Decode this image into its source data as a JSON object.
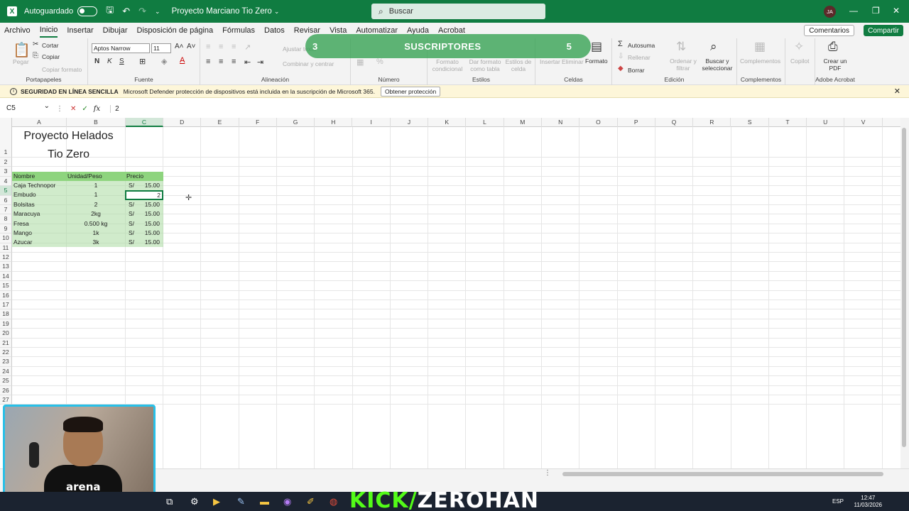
{
  "titlebar": {
    "autosave_label": "Autoguardado",
    "doc_title": "Proyecto Marciano Tio Zero",
    "search_placeholder": "Buscar",
    "avatar_initials": "JA"
  },
  "menu": {
    "tabs": [
      "Archivo",
      "Inicio",
      "Insertar",
      "Dibujar",
      "Disposición de página",
      "Fórmulas",
      "Datos",
      "Revisar",
      "Vista",
      "Automatizar",
      "Ayuda",
      "Acrobat"
    ],
    "comments": "Comentarios",
    "share": "Compartir"
  },
  "ribbon": {
    "clipboard": {
      "paste": "Pegar",
      "cut": "Cortar",
      "copy": "Copiar",
      "format_painter": "Copiar formato",
      "label": "Portapapeles"
    },
    "font": {
      "name": "Aptos Narrow",
      "size": "11",
      "bold": "N",
      "italic": "K",
      "underline": "S",
      "label": "Fuente"
    },
    "alignment": {
      "wrap": "Ajustar texto",
      "merge": "Combinar y centrar",
      "label": "Alineación"
    },
    "number": {
      "label": "Número"
    },
    "styles": {
      "conditional": "Formato condicional",
      "table": "Dar formato como tabla",
      "cell_styles": "Estilos de celda",
      "label": "Estilos"
    },
    "cells": {
      "insert": "Insertar",
      "delete": "Eliminar",
      "format": "Formato",
      "label": "Celdas"
    },
    "editing": {
      "autosum": "Autosuma",
      "fill": "Rellenar",
      "clear": "Borrar",
      "sort": "Ordenar y filtrar",
      "find": "Buscar y seleccionar",
      "label": "Edición"
    },
    "addins": {
      "label": "Complementos",
      "button": "Complementos"
    },
    "copilot": "Copilot",
    "acrobat": {
      "create_pdf": "Crear un PDF",
      "label": "Adobe Acrobat"
    }
  },
  "overlay": {
    "left_number": "3",
    "label": "SUSCRIPTORES",
    "right_number": "5"
  },
  "infobar": {
    "title": "SEGURIDAD EN LÍNEA SENCILLA",
    "message": "Microsoft Defender protección de dispositivos está incluida en la suscripción de Microsoft 365.",
    "button": "Obtener protección"
  },
  "formula": {
    "name_box": "C5",
    "value": "2"
  },
  "columns": [
    "A",
    "B",
    "C",
    "D",
    "E",
    "F",
    "G",
    "H",
    "I",
    "J",
    "K",
    "L",
    "M",
    "N",
    "O",
    "P",
    "Q",
    "R",
    "S",
    "T",
    "U",
    "V"
  ],
  "rows": [
    "1",
    "2",
    "3",
    "4",
    "5",
    "6",
    "7",
    "8",
    "9",
    "10",
    "11",
    "12",
    "13",
    "14",
    "15",
    "16",
    "17",
    "18",
    "19",
    "20",
    "21",
    "22",
    "23",
    "24",
    "25",
    "26",
    "27"
  ],
  "sheet": {
    "title_line1": "Proyecto Helados",
    "title_line2": "Tio Zero",
    "headers": {
      "a": "Nombre",
      "b": "Unidad/Peso",
      "c": "Precio"
    },
    "items": [
      {
        "name": "Caja Technopor",
        "unit": "1",
        "currency": "S/",
        "price": "15.00"
      },
      {
        "name": "Embudo",
        "unit": "1",
        "currency": "",
        "price": "2"
      },
      {
        "name": "Bolsitas",
        "unit": "2",
        "currency": "S/",
        "price": "15.00"
      },
      {
        "name": "Maracuya",
        "unit": "2kg",
        "currency": "S/",
        "price": "15.00"
      },
      {
        "name": "Fresa",
        "unit": "0.500 kg",
        "currency": "S/",
        "price": "15.00"
      },
      {
        "name": "Mango",
        "unit": "1k",
        "currency": "S/",
        "price": "15.00"
      },
      {
        "name": "Azucar",
        "unit": "3k",
        "currency": "S/",
        "price": "15.00"
      }
    ]
  },
  "taskbar": {
    "overlay_kick": "KICK/",
    "overlay_name": "ZEROHAN",
    "lang": "ESP",
    "time": "12:47",
    "date": "11/03/2026"
  },
  "webcam": {
    "shirt_text": "arena"
  },
  "colors": {
    "excel_green": "#107c41",
    "table_green": "#8ed47e",
    "kick_green": "#53fc18"
  }
}
